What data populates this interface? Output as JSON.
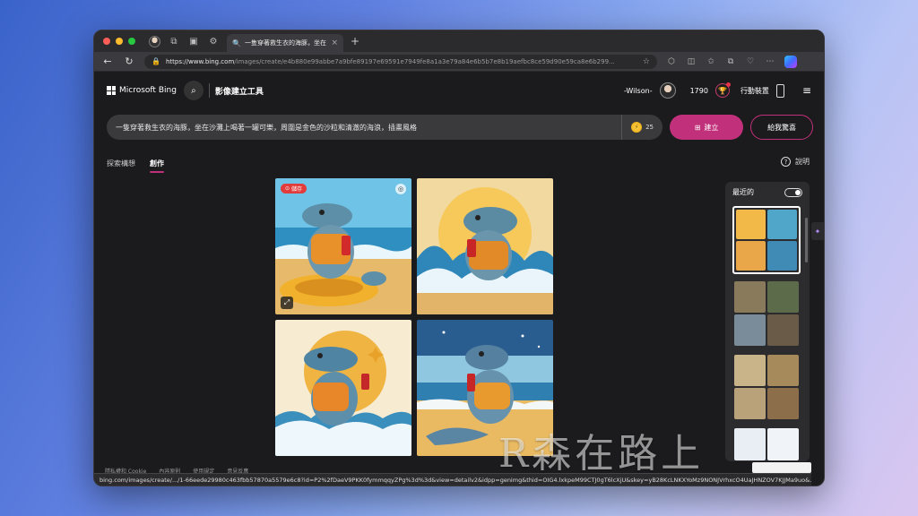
{
  "browser": {
    "tab_title": "一隻穿著救生衣的海豚，坐在沙灘上",
    "tab_close": "×",
    "new_tab": "+",
    "url_host": "https://www.bing.com",
    "url_path": "/images/create/e4b880e99abbe7a9bfe89197e69591e7949fe8a1a3e79a84e6b5b7e8b19aefbc8ce59d90e59ca8e6b299...",
    "status_url": "bing.com/images/create/.../1-66eede29980c463fbb57870a5579e6c8?id=P2%2fDaeV9PKK0fymmqqyZPg%3d%3d&view=detailv2&idpp=genimg&thid=OIG4.lxkpeM99CTJ0gT6lcXjU&skey=yB28KcLNKXYoMz9NONJVrhxcO4UaJHNZOV7KJJMa9uo&..."
  },
  "header": {
    "brand": "Microsoft Bing",
    "tool_title": "影像建立工具",
    "username": "-Wilson-",
    "points": "1790",
    "mobile_label": "行動裝置"
  },
  "prompt": {
    "text": "一隻穿著救生衣的海豚，坐在沙灘上喝著一罐可樂，周圍是金色的沙粒和清澈的海浪，插畫風格",
    "coins": "25",
    "create_label": "建立",
    "surprise_label": "給我驚喜"
  },
  "subtabs": [
    {
      "label": "探索構想"
    },
    {
      "label": "創作"
    }
  ],
  "help_label": "說明",
  "images": {
    "save_badge": "儲存"
  },
  "recent": {
    "title": "最近的",
    "sets": [
      {
        "colors": [
          "#f2b948",
          "#4fa6c8",
          "#e9a74a",
          "#3f8bb5"
        ]
      },
      {
        "colors": [
          "#8a7a5c",
          "#5c6b4a",
          "#7a8c9a",
          "#6a5b48"
        ]
      },
      {
        "colors": [
          "#c9b48a",
          "#a78a5c",
          "#b9a27a",
          "#8c6e4a"
        ]
      },
      {
        "colors": [
          "#e8eef4",
          "#f0f4f8"
        ]
      }
    ]
  },
  "footer": {
    "links": [
      "隱私權和 Cookie",
      "內容原則",
      "使用規定",
      "意見反應"
    ]
  },
  "watermark": "R森在路上",
  "colors": {
    "accent": "#c1307a",
    "background": "#1b1b1d"
  }
}
